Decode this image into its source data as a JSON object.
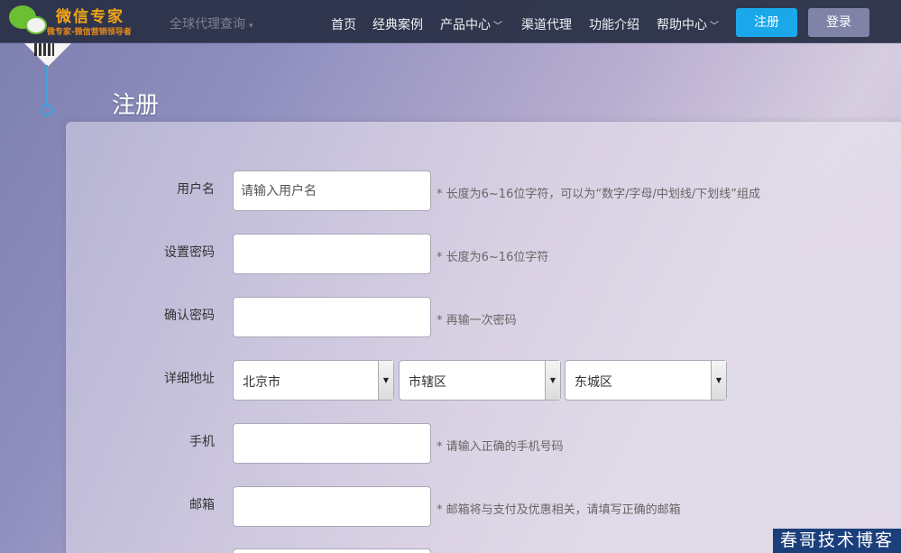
{
  "brand": {
    "title": "微信专家",
    "subtitle": "微专家-微信营销领导者"
  },
  "header": {
    "agent_query": "全球代理查询",
    "nav": [
      {
        "label": "首页",
        "dropdown": false
      },
      {
        "label": "经典案例",
        "dropdown": false
      },
      {
        "label": "产品中心",
        "dropdown": true
      },
      {
        "label": "渠道代理",
        "dropdown": false
      },
      {
        "label": "功能介绍",
        "dropdown": false
      },
      {
        "label": "帮助中心",
        "dropdown": true
      }
    ],
    "register_button": "注册",
    "login_button": "登录"
  },
  "page": {
    "title": "注册"
  },
  "form": {
    "username": {
      "label": "用户名",
      "placeholder": "请输入用户名",
      "hint": "* 长度为6~16位字符，可以为“数字/字母/中划线/下划线”组成"
    },
    "password": {
      "label": "设置密码",
      "hint": "* 长度为6~16位字符"
    },
    "confirm_password": {
      "label": "确认密码",
      "hint": "* 再输一次密码"
    },
    "address": {
      "label": "详细地址",
      "province": "北京市",
      "city": "市辖区",
      "district": "东城区"
    },
    "phone": {
      "label": "手机",
      "hint": "* 请输入正确的手机号码"
    },
    "email": {
      "label": "邮箱",
      "hint": "* 邮箱将与支付及优惠相关，请填写正确的邮箱"
    }
  },
  "watermark": "春哥技术博客",
  "colors": {
    "nav_bg": "#2c3248",
    "register_btn": "#1aa8ea",
    "login_btn": "#7f83a8",
    "logo_text": "#f4a619",
    "timeline": "#3fa3e0"
  }
}
